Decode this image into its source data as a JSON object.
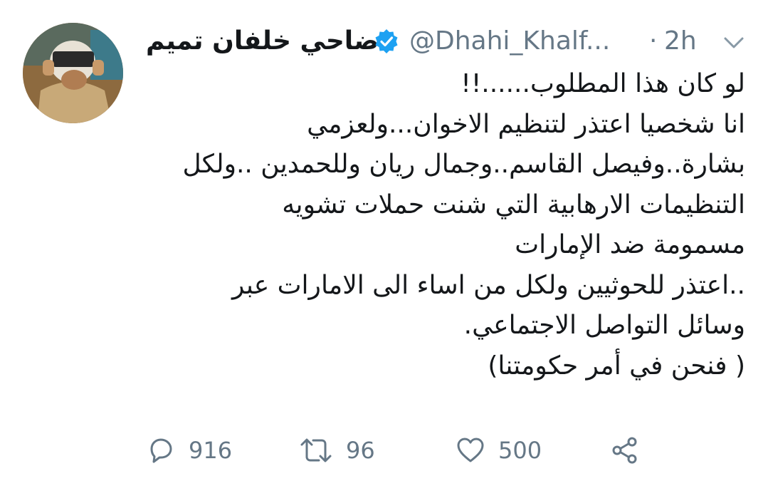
{
  "tweet": {
    "display_name": "ضاحي خلفان تميم",
    "handle": "@Dhahi_Khalf...",
    "separator": "·",
    "time": "2h",
    "verified_icon": "verified-badge-icon",
    "menu_icon": "chevron-down-icon",
    "lines": [
      "لو كان هذا المطلوب......!!",
      "انا شخصيا اعتذر لتنظيم الاخوان...ولعزمي",
      "بشارة..وفيصل القاسم..وجمال ريان وللحمدين ..ولكل",
      "التنظيمات الارهابية التي شنت حملات تشويه",
      "مسمومة ضد الإمارات",
      "..اعتذر للحوثيين ولكل من اساء الى الامارات عبر",
      "وسائل التواصل الاجتماعي.",
      "( فنحن في أمر حكومتنا)"
    ]
  },
  "actions": {
    "reply": {
      "icon": "reply-icon",
      "count": "916"
    },
    "retweet": {
      "icon": "retweet-icon",
      "count": "96"
    },
    "like": {
      "icon": "heart-icon",
      "count": "500"
    },
    "share": {
      "icon": "share-icon"
    }
  },
  "colors": {
    "text": "#14171a",
    "muted": "#657786",
    "verified": "#1da1f2"
  }
}
